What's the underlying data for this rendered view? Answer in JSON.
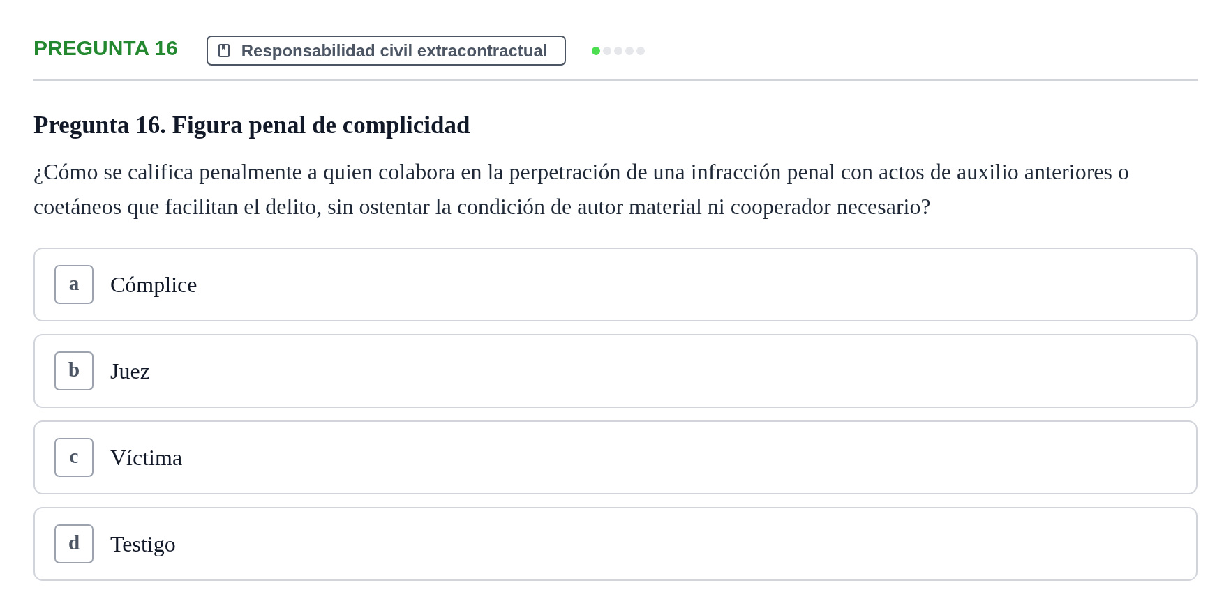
{
  "header": {
    "question_label": "PREGUNTA 16",
    "topic_tag": {
      "label": "Responsabilidad civil extracontractual"
    },
    "level_dots": [
      {
        "on": true
      },
      {
        "on": false
      },
      {
        "on": false
      },
      {
        "on": false
      },
      {
        "on": false
      }
    ]
  },
  "question": {
    "title": "Pregunta 16. Figura penal de complicidad",
    "text": "¿Cómo se califica penalmente a quien colabora en la perpetración de una infracción penal con actos de auxilio anteriores o coetáneos que facilitan el delito, sin ostentar la condición de autor material ni cooperador necesario?"
  },
  "options": [
    {
      "letter": "a",
      "text": "Cómplice",
      "selected": false
    },
    {
      "letter": "b",
      "text": "Juez",
      "selected": false
    },
    {
      "letter": "c",
      "text": "Víctima",
      "selected": false
    },
    {
      "letter": "d",
      "text": "Testigo",
      "selected": false
    }
  ]
}
